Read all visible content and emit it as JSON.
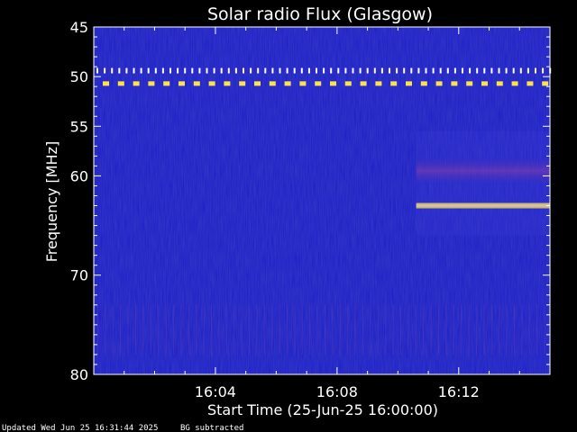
{
  "chart_data": {
    "type": "heatmap",
    "title": "Solar radio Flux (Glasgow)",
    "xlabel": "Start Time (25-Jun-25 16:00:00)",
    "ylabel": "Frequency [MHz]",
    "x_unit": "minutes after 16:00:00",
    "xlim": [
      0,
      15
    ],
    "ylim": [
      80,
      45
    ],
    "y_ticks": [
      45,
      50,
      55,
      60,
      70,
      80
    ],
    "x_ticks": [
      {
        "value": 4,
        "label": "16:04"
      },
      {
        "value": 8,
        "label": "16:08"
      },
      {
        "value": 12,
        "label": "16:12"
      }
    ],
    "background_color": "#1a1ec8",
    "series": [
      {
        "frequency_mhz": 49.4,
        "intensity": "high",
        "pattern": "periodic dots",
        "t_start": 0,
        "t_end": 15
      },
      {
        "frequency_mhz": 50.7,
        "intensity": "high",
        "pattern": "intermittent bursts",
        "t_start": 0,
        "t_end": 15
      },
      {
        "frequency_mhz": 63.0,
        "intensity": "high",
        "pattern": "continuous band",
        "t_start": 10.6,
        "t_end": 15
      },
      {
        "frequency_mhz": 59.5,
        "intensity": "medium",
        "pattern": "diffuse band",
        "t_start": 10.6,
        "t_end": 15
      }
    ]
  },
  "footer": {
    "updated": "Updated Wed Jun 25 16:31:44 2025",
    "note": "BG subtracted"
  },
  "colors": {
    "page_background": "#000000",
    "text": "#ffffff",
    "spectrum_low": "#1a1ec8",
    "spectrum_high": "#ffe14a"
  }
}
